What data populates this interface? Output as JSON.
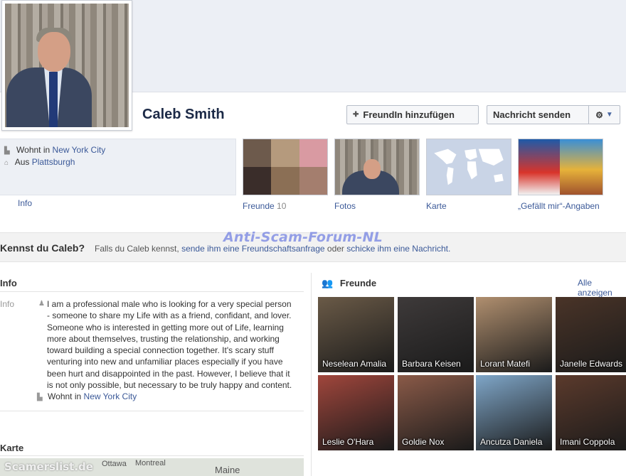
{
  "profile": {
    "name": "Caleb Smith",
    "lives_in_prefix": "Wohnt in",
    "lives_in": "New York City",
    "from_prefix": "Aus",
    "from": "Plattsburgh",
    "info_link": "Info"
  },
  "actions": {
    "add_friend": "FreundIn hinzufügen",
    "send_message": "Nachricht senden",
    "gear": "⚙"
  },
  "tiles": {
    "friends_label": "Freunde",
    "friends_count": "10",
    "photos_label": "Fotos",
    "map_label": "Karte",
    "likes_label": "„Gefällt mir“-Angaben"
  },
  "know_bar": {
    "question": "Kennst du Caleb?",
    "text_1": "Falls du Caleb kennst,",
    "link_1": "sende ihm eine Freundschaftsanfrage",
    "text_2": "oder",
    "link_2": "schicke ihm eine Nachricht."
  },
  "watermark": "Anti-Scam-Forum-NL",
  "footer_watermark": "Scamerslist.de",
  "about": {
    "section_title": "Info",
    "label": "Info",
    "text": "I am a professional male who is looking for a very special person - someone to share my Life with as a friend, confidant, and lover. Someone who is interested in getting more out of Life, learning more about themselves, trusting the relationship, and working toward building a special connection together. It's scary stuff venturing into new and unfamiliar places especially if you have been hurt and disappointed in the past. However, I believe that it is not only possible, but necessary to be truly happy and content.",
    "lives_prefix": "Wohnt in",
    "lives_city": "New York City"
  },
  "map_section": {
    "title": "Karte",
    "city_1": "Ottawa",
    "city_2": "Montreal",
    "state": "Maine"
  },
  "friends": {
    "title": "Freunde",
    "show_all": "Alle anzeigen",
    "items": [
      {
        "name": "Neselean Amalia",
        "color": "#6a5a47"
      },
      {
        "name": "Barbara Keisen",
        "color": "#3e3a3a"
      },
      {
        "name": "Lorant Matefi",
        "color": "#b08f6f"
      },
      {
        "name": "Janelle Edwards",
        "color": "#4a3428"
      },
      {
        "name": "Leslie O'Hara",
        "color": "#a0463c"
      },
      {
        "name": "Goldie Nox",
        "color": "#8a5a48"
      },
      {
        "name": "Ancutza Daniela",
        "color": "#7fa6c8"
      },
      {
        "name": "Imani Coppola",
        "color": "#5b3a2c"
      }
    ]
  }
}
